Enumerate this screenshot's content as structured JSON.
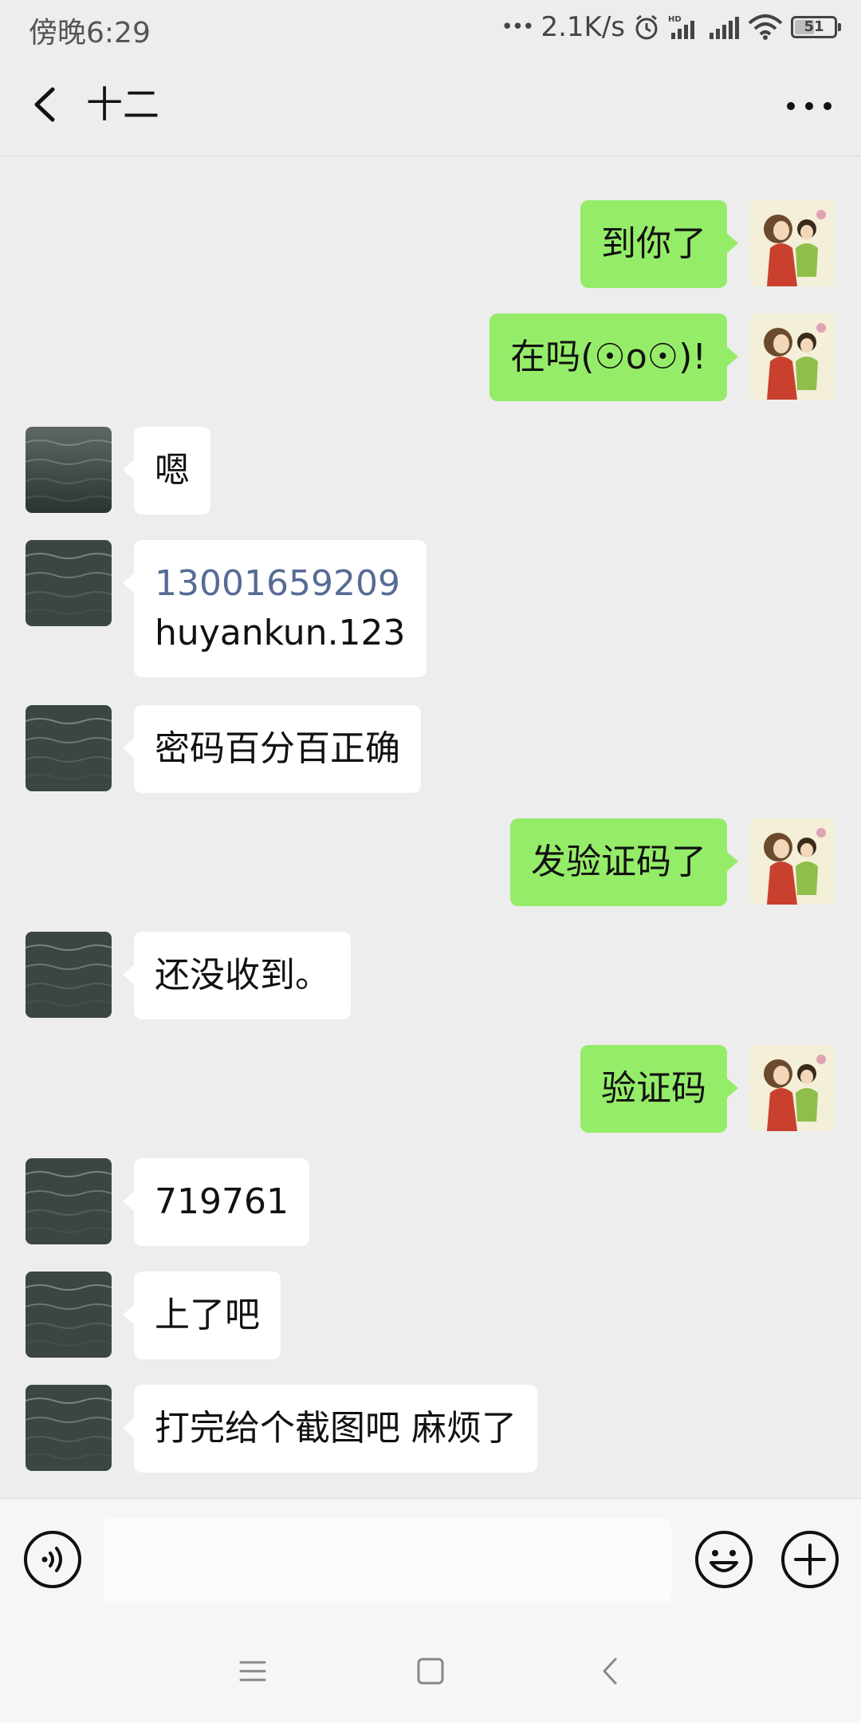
{
  "status_bar": {
    "time": "傍晚6:29",
    "dots": "•••",
    "net_speed": "2.1K/s",
    "battery": "51",
    "battery_level": 0.51
  },
  "nav": {
    "title": "十二"
  },
  "messages": [
    {
      "side": "right",
      "text": "到你了",
      "avatar": "cartoon-avatar"
    },
    {
      "side": "right",
      "text": "在吗(☉o☉)!",
      "avatar": "cartoon-avatar"
    },
    {
      "side": "left",
      "text": "嗯",
      "avatar": "sea-avatar"
    },
    {
      "side": "left",
      "lines": [
        "13001659209",
        "huyankun.123"
      ],
      "avatar": "sea-avatar"
    },
    {
      "side": "left",
      "text": "密码百分百正确",
      "avatar": "sea-avatar"
    },
    {
      "side": "right",
      "text": "发验证码了",
      "avatar": "cartoon-avatar"
    },
    {
      "side": "left",
      "text": "还没收到。",
      "avatar": "sea-avatar"
    },
    {
      "side": "right",
      "text": "验证码",
      "avatar": "cartoon-avatar"
    },
    {
      "side": "left",
      "text": "719761",
      "avatar": "sea-avatar"
    },
    {
      "side": "left",
      "text": "上了吧",
      "avatar": "sea-avatar"
    },
    {
      "side": "left",
      "text": "打完给个截图吧 麻烦了",
      "avatar": "sea-avatar"
    }
  ],
  "input": {
    "value": "",
    "placeholder": ""
  },
  "icons": {
    "back": "chevron-left-icon",
    "more": "more-icon",
    "voice": "voice-icon",
    "emoji": "emoji-icon",
    "plus": "plus-icon",
    "menu": "menu-icon",
    "home": "home-icon",
    "sys_back": "back-icon"
  },
  "colors": {
    "background": "#ededed",
    "sent_bubble": "#95ec69",
    "received_bubble": "#ffffff",
    "link": "#576b95"
  }
}
